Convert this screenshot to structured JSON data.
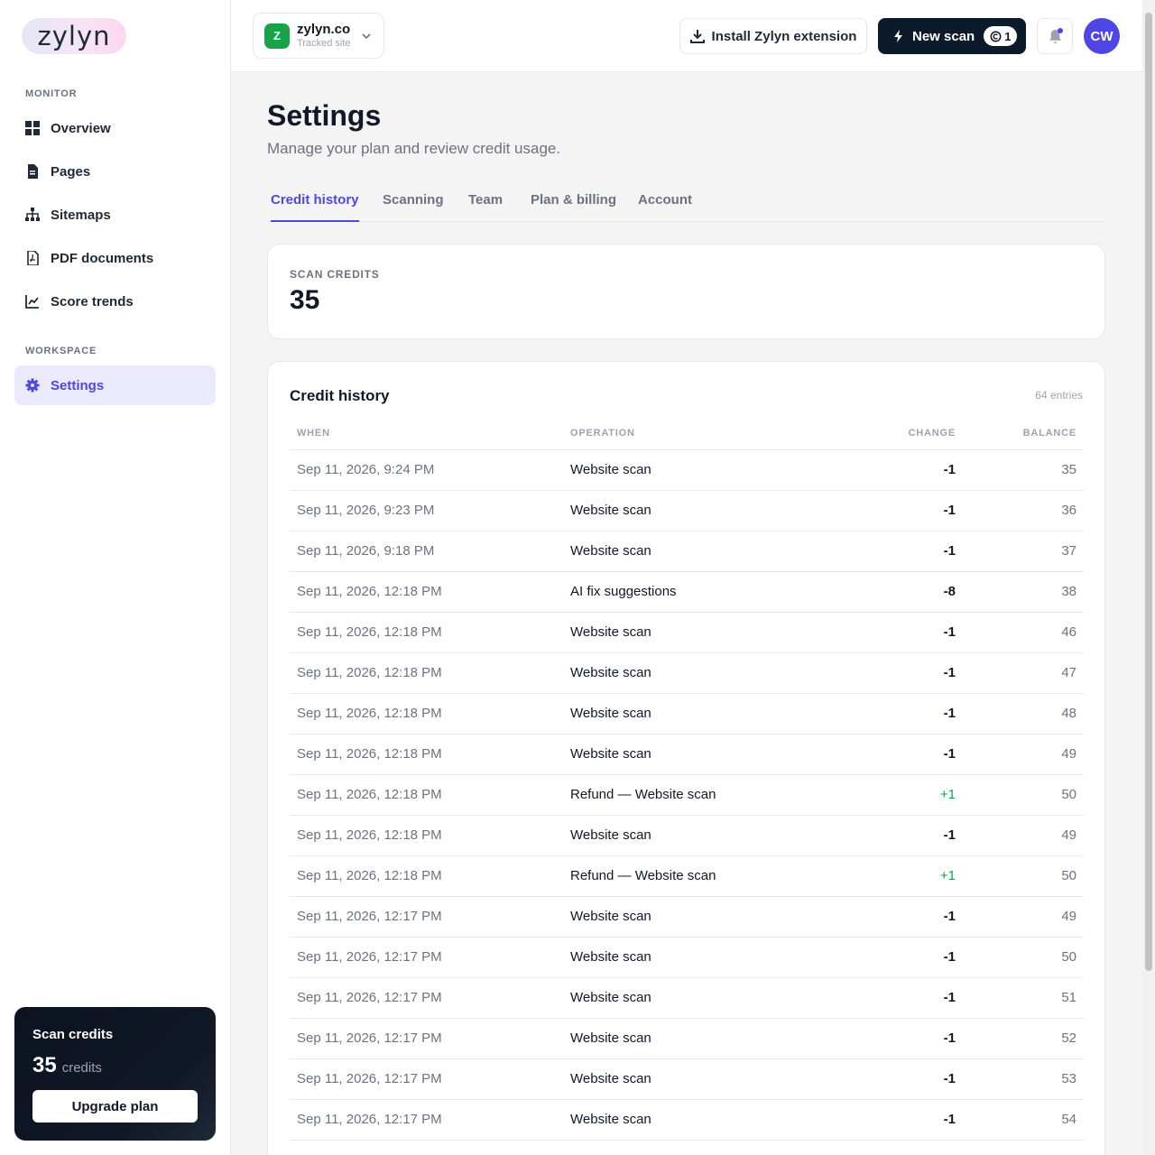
{
  "app": {
    "logo_text": "zylyn"
  },
  "sidebar": {
    "section_monitor": "MONITOR",
    "section_workspace": "WORKSPACE",
    "items": [
      {
        "label": "Overview",
        "icon": "grid-icon"
      },
      {
        "label": "Pages",
        "icon": "document-icon"
      },
      {
        "label": "Sitemaps",
        "icon": "sitemap-icon"
      },
      {
        "label": "PDF documents",
        "icon": "pdf-icon"
      },
      {
        "label": "Score trends",
        "icon": "chart-line-icon"
      },
      {
        "label": "Settings",
        "icon": "gear-icon",
        "active": true
      }
    ],
    "credit_card": {
      "title": "Scan credits",
      "amount": "35",
      "unit": "credits",
      "button": "Upgrade plan"
    }
  },
  "topbar": {
    "site": {
      "badge": "Z",
      "name": "zylyn.co",
      "subtitle": "Tracked site"
    },
    "extension_button": "Install Zylyn extension",
    "new_scan_button": "New scan",
    "new_scan_count": "1",
    "avatar_initials": "CW"
  },
  "page": {
    "title": "Settings",
    "subtitle": "Manage your plan and review credit usage."
  },
  "tabs": [
    {
      "label": "Credit history",
      "active": true
    },
    {
      "label": "Scanning"
    },
    {
      "label": "Team"
    },
    {
      "label": "Plan & billing"
    },
    {
      "label": "Account"
    }
  ],
  "credits_card": {
    "label": "SCAN CREDITS",
    "value": "35"
  },
  "history": {
    "title": "Credit history",
    "count": "64 entries",
    "columns": [
      "WHEN",
      "OPERATION",
      "CHANGE",
      "BALANCE"
    ],
    "rows": [
      {
        "when": "Sep 11, 2026, 9:24 PM",
        "operation": "Website scan",
        "change": "-1",
        "balance": "35"
      },
      {
        "when": "Sep 11, 2026, 9:23 PM",
        "operation": "Website scan",
        "change": "-1",
        "balance": "36"
      },
      {
        "when": "Sep 11, 2026, 9:18 PM",
        "operation": "Website scan",
        "change": "-1",
        "balance": "37"
      },
      {
        "when": "Sep 11, 2026, 12:18 PM",
        "operation": "AI fix suggestions",
        "change": "-8",
        "balance": "38"
      },
      {
        "when": "Sep 11, 2026, 12:18 PM",
        "operation": "Website scan",
        "change": "-1",
        "balance": "46"
      },
      {
        "when": "Sep 11, 2026, 12:18 PM",
        "operation": "Website scan",
        "change": "-1",
        "balance": "47"
      },
      {
        "when": "Sep 11, 2026, 12:18 PM",
        "operation": "Website scan",
        "change": "-1",
        "balance": "48"
      },
      {
        "when": "Sep 11, 2026, 12:18 PM",
        "operation": "Website scan",
        "change": "-1",
        "balance": "49"
      },
      {
        "when": "Sep 11, 2026, 12:18 PM",
        "operation": "Refund — Website scan",
        "change": "+1",
        "balance": "50"
      },
      {
        "when": "Sep 11, 2026, 12:18 PM",
        "operation": "Website scan",
        "change": "-1",
        "balance": "49"
      },
      {
        "when": "Sep 11, 2026, 12:18 PM",
        "operation": "Refund — Website scan",
        "change": "+1",
        "balance": "50"
      },
      {
        "when": "Sep 11, 2026, 12:17 PM",
        "operation": "Website scan",
        "change": "-1",
        "balance": "49"
      },
      {
        "when": "Sep 11, 2026, 12:17 PM",
        "operation": "Website scan",
        "change": "-1",
        "balance": "50"
      },
      {
        "when": "Sep 11, 2026, 12:17 PM",
        "operation": "Website scan",
        "change": "-1",
        "balance": "51"
      },
      {
        "when": "Sep 11, 2026, 12:17 PM",
        "operation": "Website scan",
        "change": "-1",
        "balance": "52"
      },
      {
        "when": "Sep 11, 2026, 12:17 PM",
        "operation": "Website scan",
        "change": "-1",
        "balance": "53"
      },
      {
        "when": "Sep 11, 2026, 12:17 PM",
        "operation": "Website scan",
        "change": "-1",
        "balance": "54"
      }
    ]
  },
  "colors": {
    "accent": "#4f46e5",
    "positive": "#16a34a",
    "dark": "#0b1b2b"
  }
}
